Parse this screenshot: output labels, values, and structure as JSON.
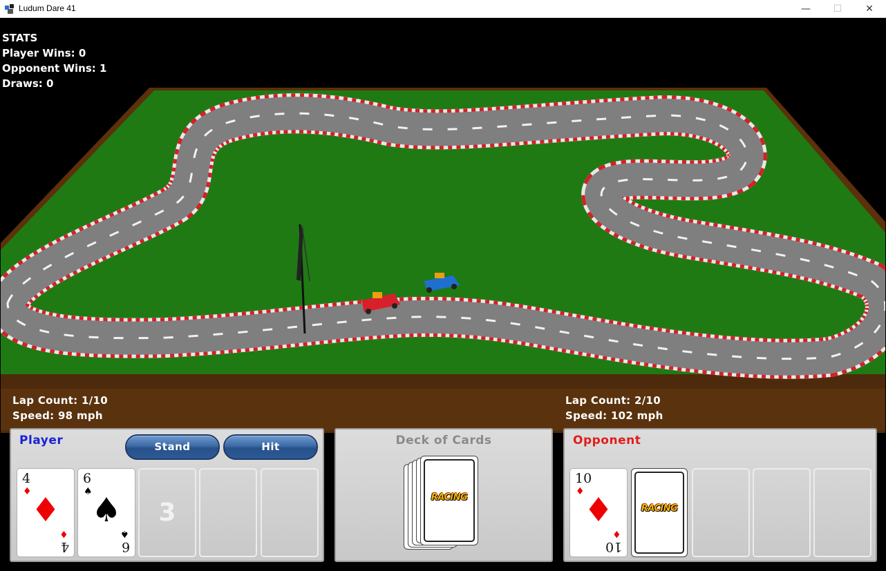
{
  "window": {
    "title": "Ludum Dare 41",
    "min_glyph": "—",
    "max_glyph": "☐",
    "close_glyph": "✕"
  },
  "stats": {
    "heading": "STATS",
    "player_wins": "Player Wins: 0",
    "opponent_wins": "Opponent Wins: 1",
    "draws": "Draws: 0"
  },
  "player_info": {
    "lap": "Lap Count: 1/10",
    "speed": "Speed: 98 mph"
  },
  "opponent_info": {
    "lap": "Lap Count: 2/10",
    "speed": "Speed: 102 mph"
  },
  "player_panel": {
    "title": "Player",
    "stand_label": "Stand",
    "hit_label": "Hit",
    "cards": [
      {
        "rank": "4",
        "suit": "♦",
        "color": "red"
      },
      {
        "rank": "6",
        "suit": "♠",
        "color": "black"
      }
    ],
    "next_slot_number": "3"
  },
  "deck_panel": {
    "title": "Deck of Cards",
    "logo": "RACING"
  },
  "opponent_panel": {
    "title": "Opponent",
    "cards": [
      {
        "rank": "10",
        "suit": "♦",
        "color": "red"
      }
    ],
    "face_down_logo": "RACING"
  },
  "colors": {
    "grass": "#1f7a14",
    "wood": "#6b3a0c",
    "asphalt": "#808080",
    "player_car": "#d8202a",
    "opponent_car": "#1f6fd0",
    "player_title": "#1a22d8",
    "opponent_title": "#e21c1c"
  }
}
